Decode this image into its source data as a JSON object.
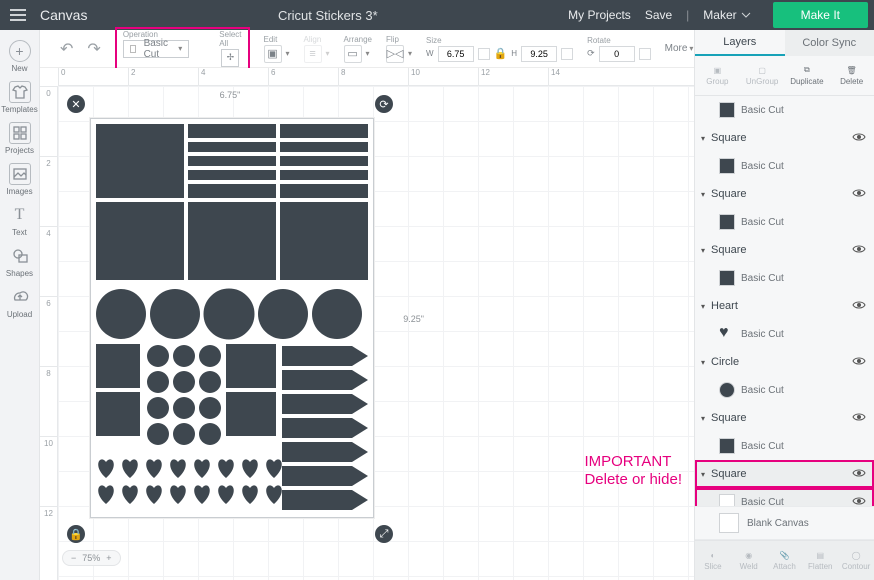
{
  "topbar": {
    "app": "Canvas",
    "title": "Cricut Stickers 3*",
    "my_projects": "My Projects",
    "save": "Save",
    "machine": "Maker",
    "makeit": "Make It"
  },
  "leftbar": {
    "items": [
      {
        "label": "New"
      },
      {
        "label": "Templates"
      },
      {
        "label": "Projects"
      },
      {
        "label": "Images"
      },
      {
        "label": "Text"
      },
      {
        "label": "Shapes"
      },
      {
        "label": "Upload"
      }
    ]
  },
  "tools": {
    "operation_lbl": "Operation",
    "operation_val": "Basic Cut",
    "selectall_lbl": "Select All",
    "edit_lbl": "Edit",
    "align_lbl": "Align",
    "arrange_lbl": "Arrange",
    "flip_lbl": "Flip",
    "size_lbl": "Size",
    "size_w": "6.75",
    "size_h": "9.25",
    "rotate_lbl": "Rotate",
    "rotate_val": "0",
    "more": "More"
  },
  "canvas": {
    "ruler_h": [
      "0",
      "2",
      "4",
      "6",
      "8",
      "10",
      "12",
      "14"
    ],
    "ruler_v": [
      "0",
      "2",
      "4",
      "6",
      "8",
      "10",
      "12"
    ],
    "sel_w": "6.75\"",
    "sel_h": "9.25\"",
    "zoom": "75%"
  },
  "panel": {
    "tab_layers": "Layers",
    "tab_colorsync": "Color Sync",
    "actions": {
      "group": "Group",
      "ungroup": "UnGroup",
      "duplicate": "Duplicate",
      "delete": "Delete"
    },
    "layers": [
      {
        "type": "child",
        "label": "Basic Cut",
        "swatch": "#3e474f"
      },
      {
        "type": "parent",
        "label": "Square"
      },
      {
        "type": "child",
        "label": "Basic Cut",
        "swatch": "#3e474f"
      },
      {
        "type": "parent",
        "label": "Square"
      },
      {
        "type": "child",
        "label": "Basic Cut",
        "swatch": "#3e474f"
      },
      {
        "type": "parent",
        "label": "Square"
      },
      {
        "type": "child",
        "label": "Basic Cut",
        "swatch": "#3e474f"
      },
      {
        "type": "parent",
        "label": "Heart"
      },
      {
        "type": "child",
        "label": "Basic Cut",
        "swatch": "#3e474f",
        "shape": "heart"
      },
      {
        "type": "parent",
        "label": "Circle"
      },
      {
        "type": "child",
        "label": "Basic Cut",
        "swatch": "#3e474f",
        "shape": "circle"
      },
      {
        "type": "parent",
        "label": "Square"
      },
      {
        "type": "child",
        "label": "Basic Cut",
        "swatch": "#3e474f"
      },
      {
        "type": "parent",
        "label": "Square",
        "hl": true,
        "red": true
      },
      {
        "type": "child",
        "label": "Basic Cut",
        "swatch": "#ffffff",
        "hl": true,
        "red": true
      }
    ],
    "blank": "Blank Canvas",
    "btools": {
      "slice": "Slice",
      "weld": "Weld",
      "attach": "Attach",
      "flatten": "Flatten",
      "contour": "Contour"
    }
  },
  "annotation": {
    "l1": "IMPORTANT",
    "l2": "Delete or hide!"
  }
}
